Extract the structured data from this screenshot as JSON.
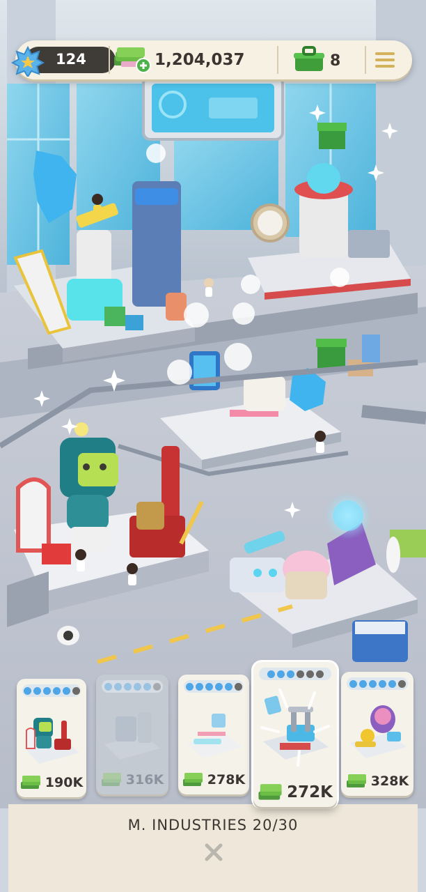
{
  "hud": {
    "level": "124",
    "cash": "1,204,037",
    "boxes": "8",
    "icons": {
      "level": "star-badge-icon",
      "cash": "cash-stack-plus-icon",
      "boxes": "green-toolbox-icon",
      "menu": "hamburger-menu-icon"
    }
  },
  "cards": [
    {
      "price": "190K",
      "progress": 5,
      "progress_max": 6,
      "state": "available",
      "art": "robot-assembly"
    },
    {
      "price": "316K",
      "progress": 5,
      "progress_max": 6,
      "state": "locked",
      "art": "workshop"
    },
    {
      "price": "278K",
      "progress": 5,
      "progress_max": 6,
      "state": "available",
      "art": "lab-platform"
    },
    {
      "price": "272K",
      "progress": 3,
      "progress_max": 6,
      "state": "active",
      "art": "press-machine"
    },
    {
      "price": "328K",
      "progress": 5,
      "progress_max": 6,
      "state": "available",
      "art": "robot-head-station"
    }
  ],
  "footer": {
    "title": "M. INDUSTRIES 20/30",
    "close_icon": "close-x-icon"
  },
  "colors": {
    "accent_blue": "#4fa6e6",
    "dot_empty": "#6b6a66",
    "cash_green": "#6bbd45",
    "tray": "#efe8da"
  }
}
